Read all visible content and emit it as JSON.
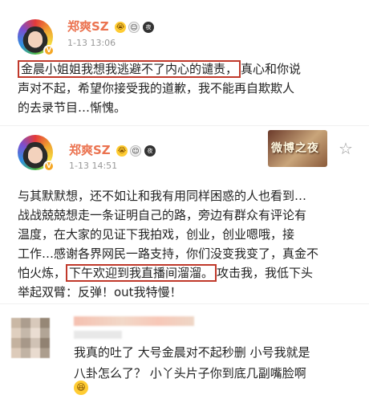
{
  "post1": {
    "username": "郑爽SZ",
    "emoji_icons": [
      "crying-face-icon",
      "face-icon",
      "night-badge-icon"
    ],
    "night_badge": "夜",
    "time": "1-13 13:06",
    "highlight": "金晨小姐姐我想我逃避不了内心的谴责，",
    "text_rest_line1": "真心和你说",
    "text_line2": "声对不起，希望你接受我的道歉，我不能再自欺欺人",
    "text_line3": "的去录节目…惭愧。"
  },
  "post2": {
    "username": "郑爽SZ",
    "emoji_icons": [
      "crying-face-icon",
      "face-icon",
      "night-badge-icon"
    ],
    "night_badge": "夜",
    "time": "1-13 14:51",
    "banner_text": "微博之夜",
    "line1": "与其默默想，还不如让和我有用同样困惑的人也看到…",
    "line2": "战战兢兢想走一条证明自己的路，旁边有群众有评论有",
    "line3": "温度，在大家的见证下我拍戏，创业，创业嗯哦，接",
    "line4": "工作…感谢各界网民一路支持，你们没变我变了，真金不",
    "line5_pre": "怕火炼，",
    "highlight": "下午欢迎到我直播间溜溜。",
    "line5_post": "攻击我，我低下头",
    "line6": "举起双臂：反弹！out我特慢！"
  },
  "comment": {
    "line1": "我真的吐了 大号金晨对不起秒删 小号我就是",
    "line2": "八卦怎么了？ 小丫头片子你到底几副嘴脸啊",
    "emoji": "laughing-face-icon"
  },
  "colors": {
    "username": "#eb7350",
    "highlight_border": "#c0392b",
    "verified_badge": "#f5a623"
  }
}
